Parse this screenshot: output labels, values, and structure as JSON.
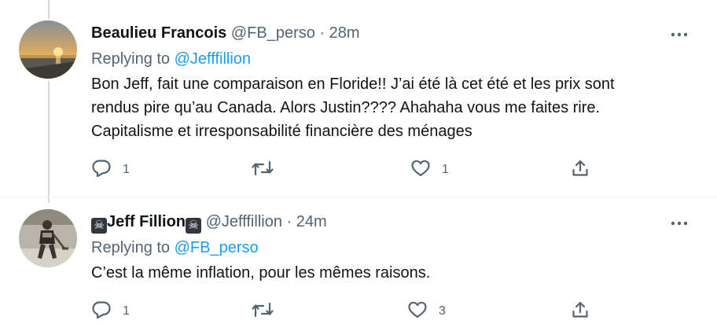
{
  "tweets": [
    {
      "display_name": "Beaulieu Francois",
      "name_prefix_emoji": "",
      "name_suffix_emoji": "",
      "handle": "@FB_perso",
      "separator": "·",
      "time": "28m",
      "replying_label": "Replying to",
      "replying_to": "@Jefffillion",
      "body_lines": [
        "Bon Jeff, fait une comparaison en Floride!! J’ai été là cet été et les prix sont",
        "rendus pire qu’au Canada. Alors Justin???? Ahahaha vous me faites rire.",
        "Capitalisme et irresponsabilité financière des ménages"
      ],
      "reply_count": "1",
      "retweet_count": "",
      "like_count": "1",
      "avatar": "sunset-beach"
    },
    {
      "display_name": "Jeff Fillion",
      "name_prefix_emoji": "☠",
      "name_suffix_emoji": "☠",
      "handle": "@Jefffillion",
      "separator": "·",
      "time": "24m",
      "replying_label": "Replying to",
      "replying_to": "@FB_perso",
      "body_lines": [
        "C’est la même inflation, pour les mêmes raisons."
      ],
      "reply_count": "1",
      "retweet_count": "",
      "like_count": "3",
      "avatar": "hockey-player"
    }
  ],
  "icons": {
    "more": "more-horizontal-icon",
    "reply": "reply-bubble-icon",
    "retweet": "retweet-icon",
    "like": "heart-icon",
    "share": "share-icon"
  },
  "colors": {
    "text": "#0f1419",
    "secondary": "#536471",
    "link": "#1d9bf0",
    "thread_line": "#cfd9de"
  }
}
